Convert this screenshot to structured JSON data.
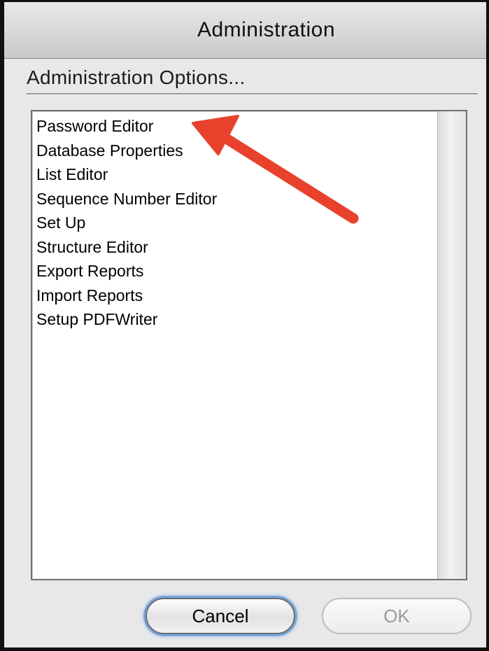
{
  "window": {
    "title": "Administration"
  },
  "options": {
    "heading": "Administration Options...",
    "items": [
      "Password Editor",
      "Database Properties",
      "List Editor",
      "Sequence Number Editor",
      "Set Up",
      "Structure Editor",
      "Export Reports",
      "Import Reports",
      "Setup PDFWriter"
    ]
  },
  "buttons": {
    "cancel_label": "Cancel",
    "ok_label": "OK",
    "ok_enabled": false
  },
  "annotation": {
    "arrow_icon": "red-arrow-icon",
    "arrow_color": "#e8412c",
    "points_to": "Password Editor"
  },
  "colors": {
    "focus_ring": "#7aa7e0",
    "window_bg": "#e8e8e8"
  }
}
